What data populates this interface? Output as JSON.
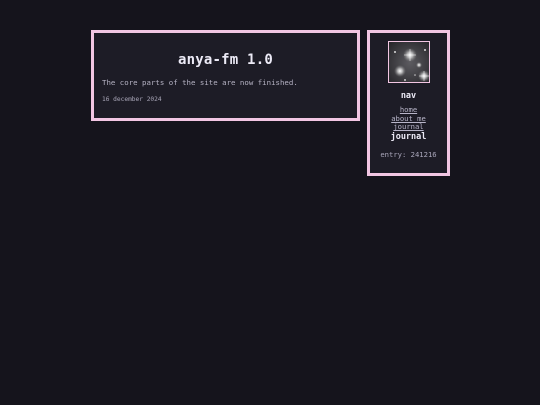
{
  "post": {
    "title": "anya-fm 1.0",
    "body": "The core parts of the site are now finished.",
    "date": "16 december 2024"
  },
  "sidebar": {
    "avatar_alt": "starfield",
    "nav_heading": "nav",
    "nav_links": [
      {
        "label": "home"
      },
      {
        "label": "about me"
      },
      {
        "label": "journal"
      }
    ],
    "section_heading": "journal",
    "entry_label": "entry: 241216"
  },
  "colors": {
    "background": "#15141c",
    "panel": "#1d1c26",
    "border_accent": "#f2c6e3",
    "text_primary": "#eceaf6",
    "text_muted": "#b6b3c4"
  }
}
